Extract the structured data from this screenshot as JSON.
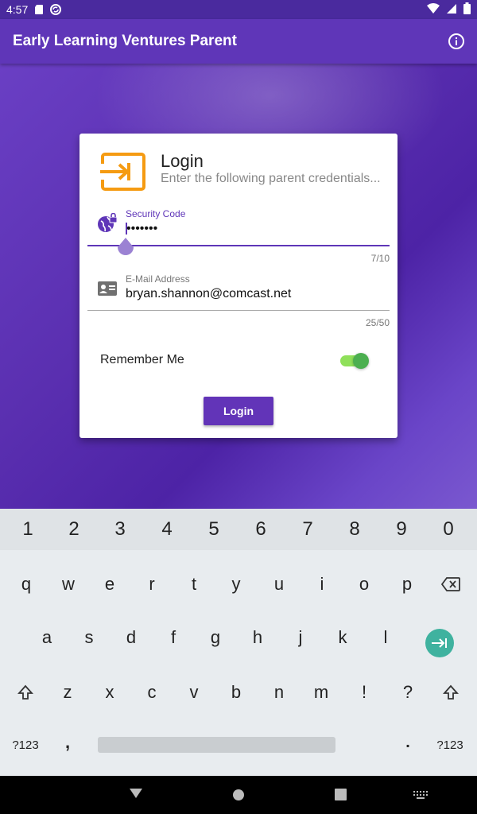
{
  "status_bar": {
    "time": "4:57",
    "left_icons": [
      "sd-card-icon",
      "sync-icon"
    ],
    "right_icons": [
      "wifi-icon",
      "signal-icon",
      "battery-icon"
    ]
  },
  "app_bar": {
    "title": "Early Learning Ventures Parent",
    "action_icon": "info-icon"
  },
  "login_card": {
    "title": "Login",
    "subtitle": "Enter the following parent credentials...",
    "security_code": {
      "label": "Security Code",
      "value": "•••••••",
      "counter": "7/10",
      "icon": "globe-lock-icon"
    },
    "email": {
      "label": "E-Mail Address",
      "value": "bryan.shannon@comcast.net",
      "counter": "25/50",
      "icon": "contact-card-icon"
    },
    "remember_me": {
      "label": "Remember Me",
      "checked": true
    },
    "login_button_label": "Login"
  },
  "keyboard": {
    "number_row": [
      "1",
      "2",
      "3",
      "4",
      "5",
      "6",
      "7",
      "8",
      "9",
      "0"
    ],
    "row1": [
      "q",
      "w",
      "e",
      "r",
      "t",
      "y",
      "u",
      "i",
      "o",
      "p"
    ],
    "row2": [
      "a",
      "s",
      "d",
      "f",
      "g",
      "h",
      "j",
      "k",
      "l"
    ],
    "row3": [
      "z",
      "x",
      "c",
      "v",
      "b",
      "n",
      "m",
      "!",
      "?"
    ],
    "symbols_label": "?123",
    "comma": ",",
    "period": "."
  },
  "colors": {
    "primary": "#5f36b8",
    "accent_orange": "#f59b12",
    "switch_on": "#4caf50",
    "enter_key": "#3fb29f"
  }
}
